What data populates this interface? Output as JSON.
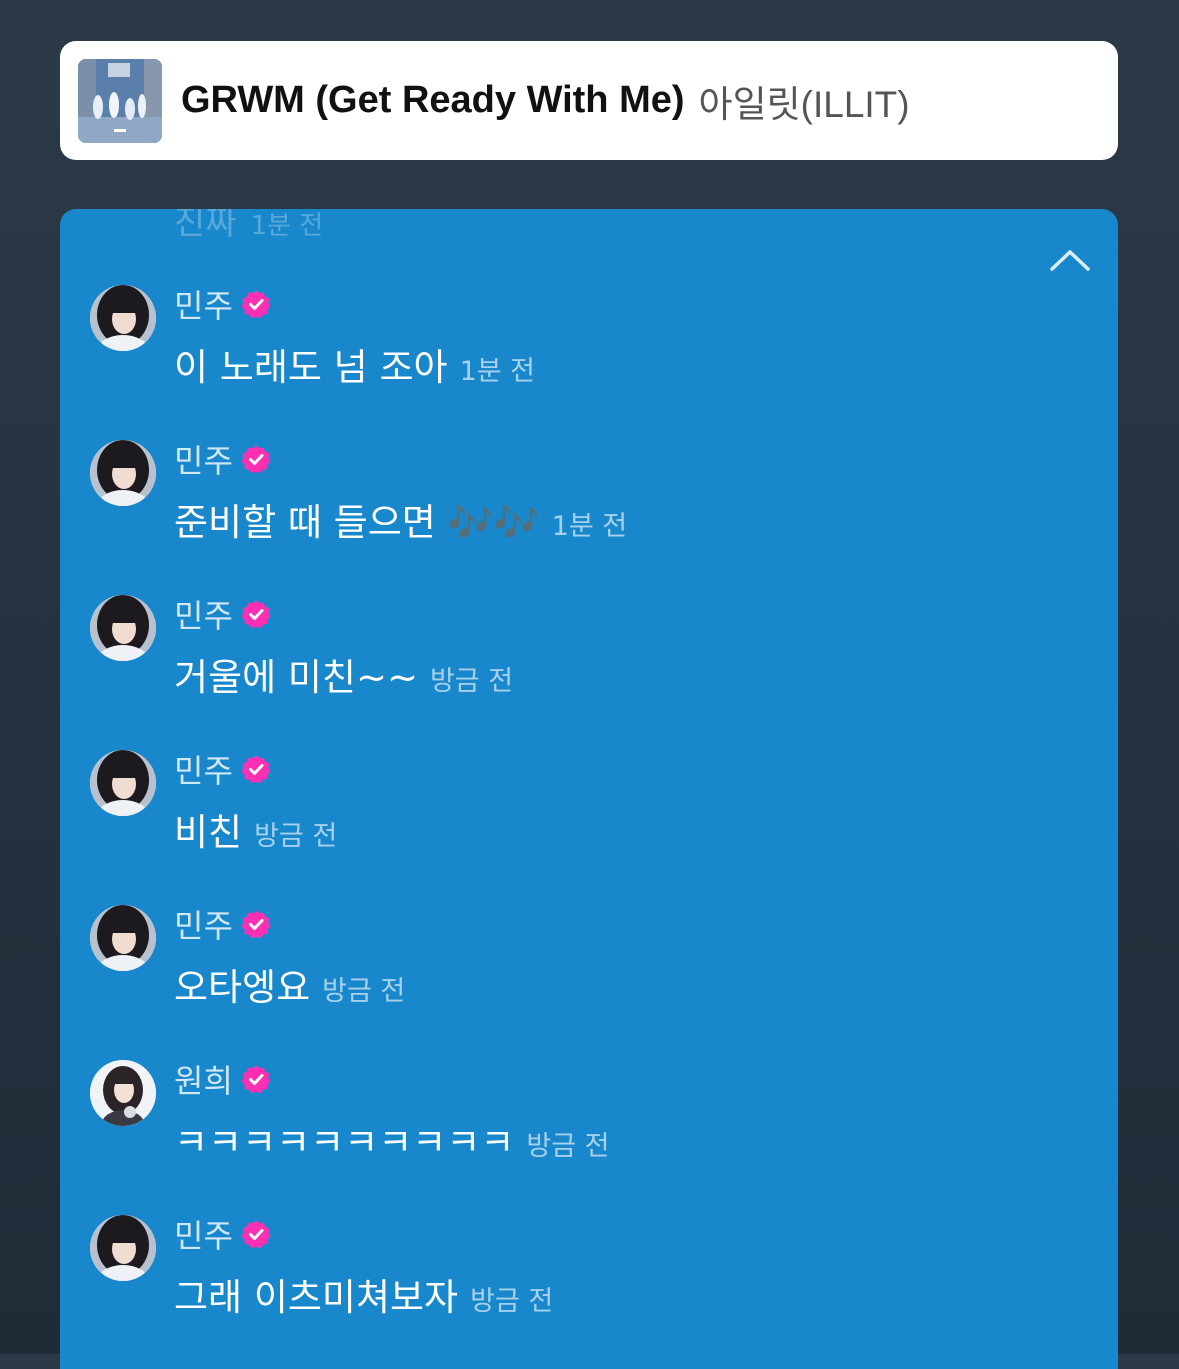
{
  "now_playing": {
    "title": "GRWM (Get Ready With Me)",
    "artist": "아일릿(ILLIT)",
    "album_art_icon": "album-cover-image"
  },
  "chat": {
    "faded_message": {
      "text": "진짜",
      "time": "1분 전"
    },
    "collapse_icon": "chevron-up-icon",
    "verified_color": "#ff2fb4",
    "messages": [
      {
        "user": "민주",
        "text": "이 노래도 넘 조아",
        "time": "1분 전",
        "verified": true
      },
      {
        "user": "민주",
        "text": "준비할 때 들으면 🎶🎶",
        "time": "1분 전",
        "verified": true
      },
      {
        "user": "민주",
        "text": "거울에 미친~~",
        "time": "방금 전",
        "verified": true
      },
      {
        "user": "민주",
        "text": "비친",
        "time": "방금 전",
        "verified": true
      },
      {
        "user": "민주",
        "text": "오타엥요",
        "time": "방금 전",
        "verified": true
      },
      {
        "user": "원희",
        "text": "ㅋㅋㅋㅋㅋㅋㅋㅋㅋㅋ",
        "time": "방금 전",
        "verified": true
      },
      {
        "user": "민주",
        "text": "그래 이츠미쳐보자",
        "time": "방금 전",
        "verified": true
      }
    ]
  }
}
